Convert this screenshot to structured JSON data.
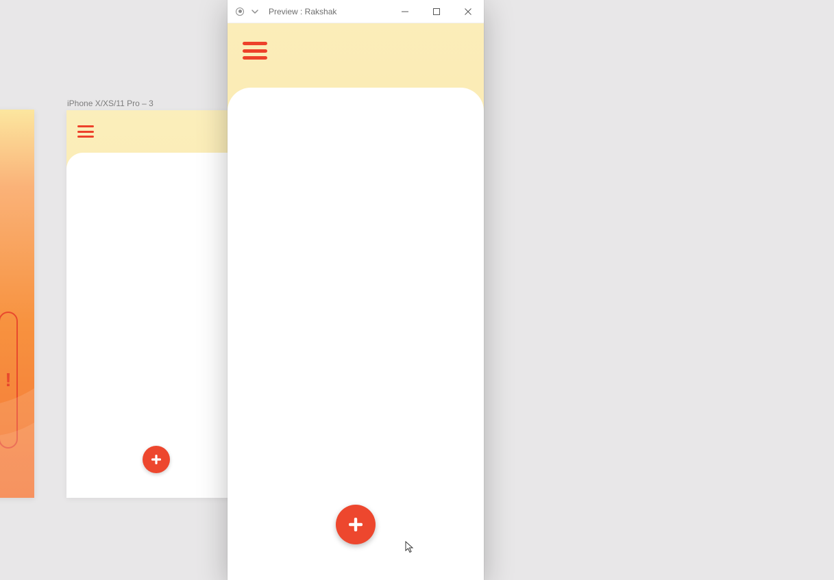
{
  "canvas": {
    "artboard_label": "iPhone X/XS/11 Pro – 3"
  },
  "preview_window": {
    "title": "Preview : Rakshak"
  },
  "icons": {
    "hamburger": "menu-icon",
    "fab_plus": "plus-icon",
    "minimize": "minimize-icon",
    "maximize": "maximize-icon",
    "close": "close-icon",
    "chevron": "chevron-down-icon",
    "home": "home-artboard-icon"
  },
  "colors": {
    "accent_red": "#ed412a",
    "fab_red": "#ed472e",
    "header_cream_top": "#fbedb9",
    "header_cream_bottom": "#fbe5a0",
    "canvas_bg": "#e8e7e8"
  }
}
